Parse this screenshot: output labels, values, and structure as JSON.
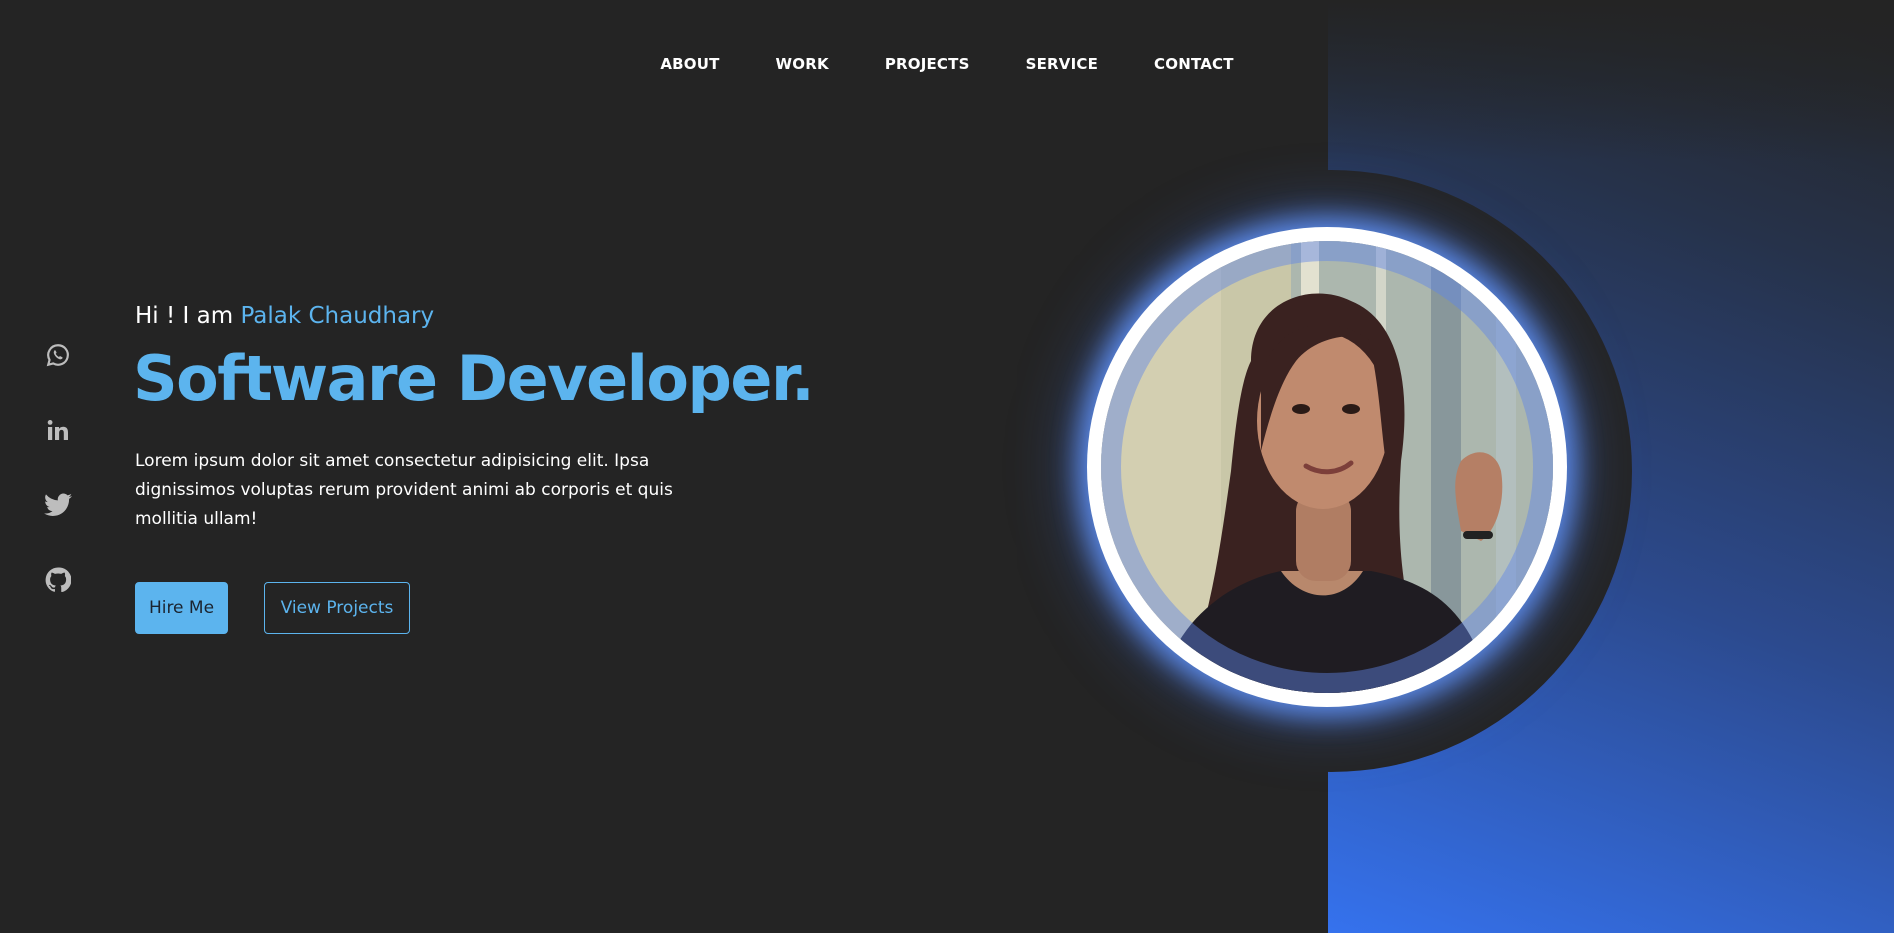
{
  "nav": {
    "items": [
      {
        "label": "ABOUT"
      },
      {
        "label": "WORK"
      },
      {
        "label": "PROJECTS"
      },
      {
        "label": "SERVICE"
      },
      {
        "label": "CONTACT"
      }
    ]
  },
  "social": {
    "icons": [
      "whatsapp-icon",
      "linkedin-icon",
      "twitter-icon",
      "github-icon"
    ]
  },
  "hero": {
    "greeting_prefix": "Hi ! I am ",
    "name": "Palak Chaudhary",
    "headline": "Software Developer.",
    "description": "Lorem ipsum dolor sit amet consectetur adipisicing elit. Ipsa dignissimos voluptas rerum provident animi ab corporis et quis mollitia ullam!",
    "hire_label": "Hire Me",
    "view_label": "View Projects"
  },
  "colors": {
    "background": "#242424",
    "accent": "#5cb4ee",
    "gradient_end": "#3572ee",
    "icon": "#bdbdbd"
  }
}
